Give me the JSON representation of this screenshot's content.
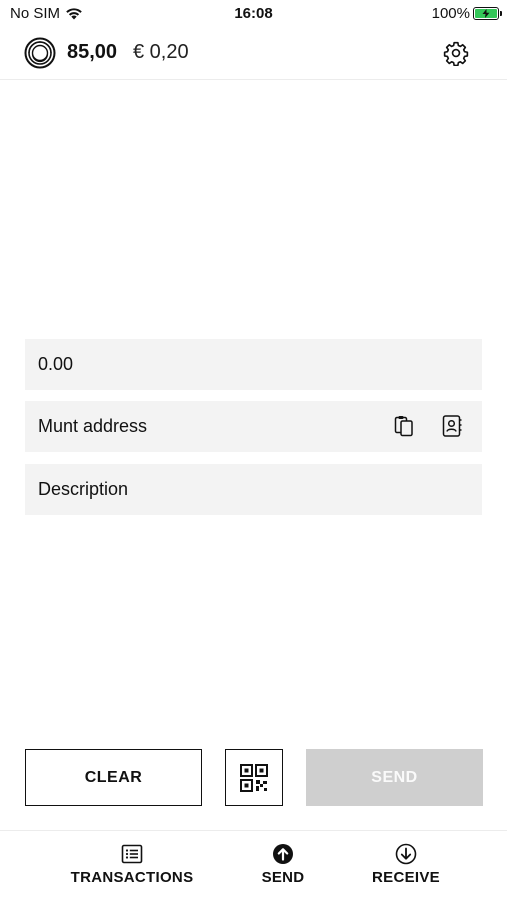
{
  "status_bar": {
    "carrier": "No SIM",
    "time": "16:08",
    "battery": "100%"
  },
  "header": {
    "balance": "85,00",
    "fiat_value": "€ 0,20"
  },
  "form": {
    "amount_placeholder": "0.00",
    "address_placeholder": "Munt address",
    "description_placeholder": "Description"
  },
  "actions": {
    "clear_label": "CLEAR",
    "send_label": "SEND",
    "send_enabled": false
  },
  "tabbar": {
    "tabs": [
      {
        "label": "TRANSACTIONS",
        "icon": "list-icon"
      },
      {
        "label": "SEND",
        "icon": "arrow-up-circle-icon"
      },
      {
        "label": "RECEIVE",
        "icon": "arrow-down-circle-icon"
      }
    ],
    "active": "SEND"
  },
  "colors": {
    "field_bg": "#f3f3f3",
    "disabled_button": "#cfcfcf",
    "battery_green": "#34c759"
  }
}
